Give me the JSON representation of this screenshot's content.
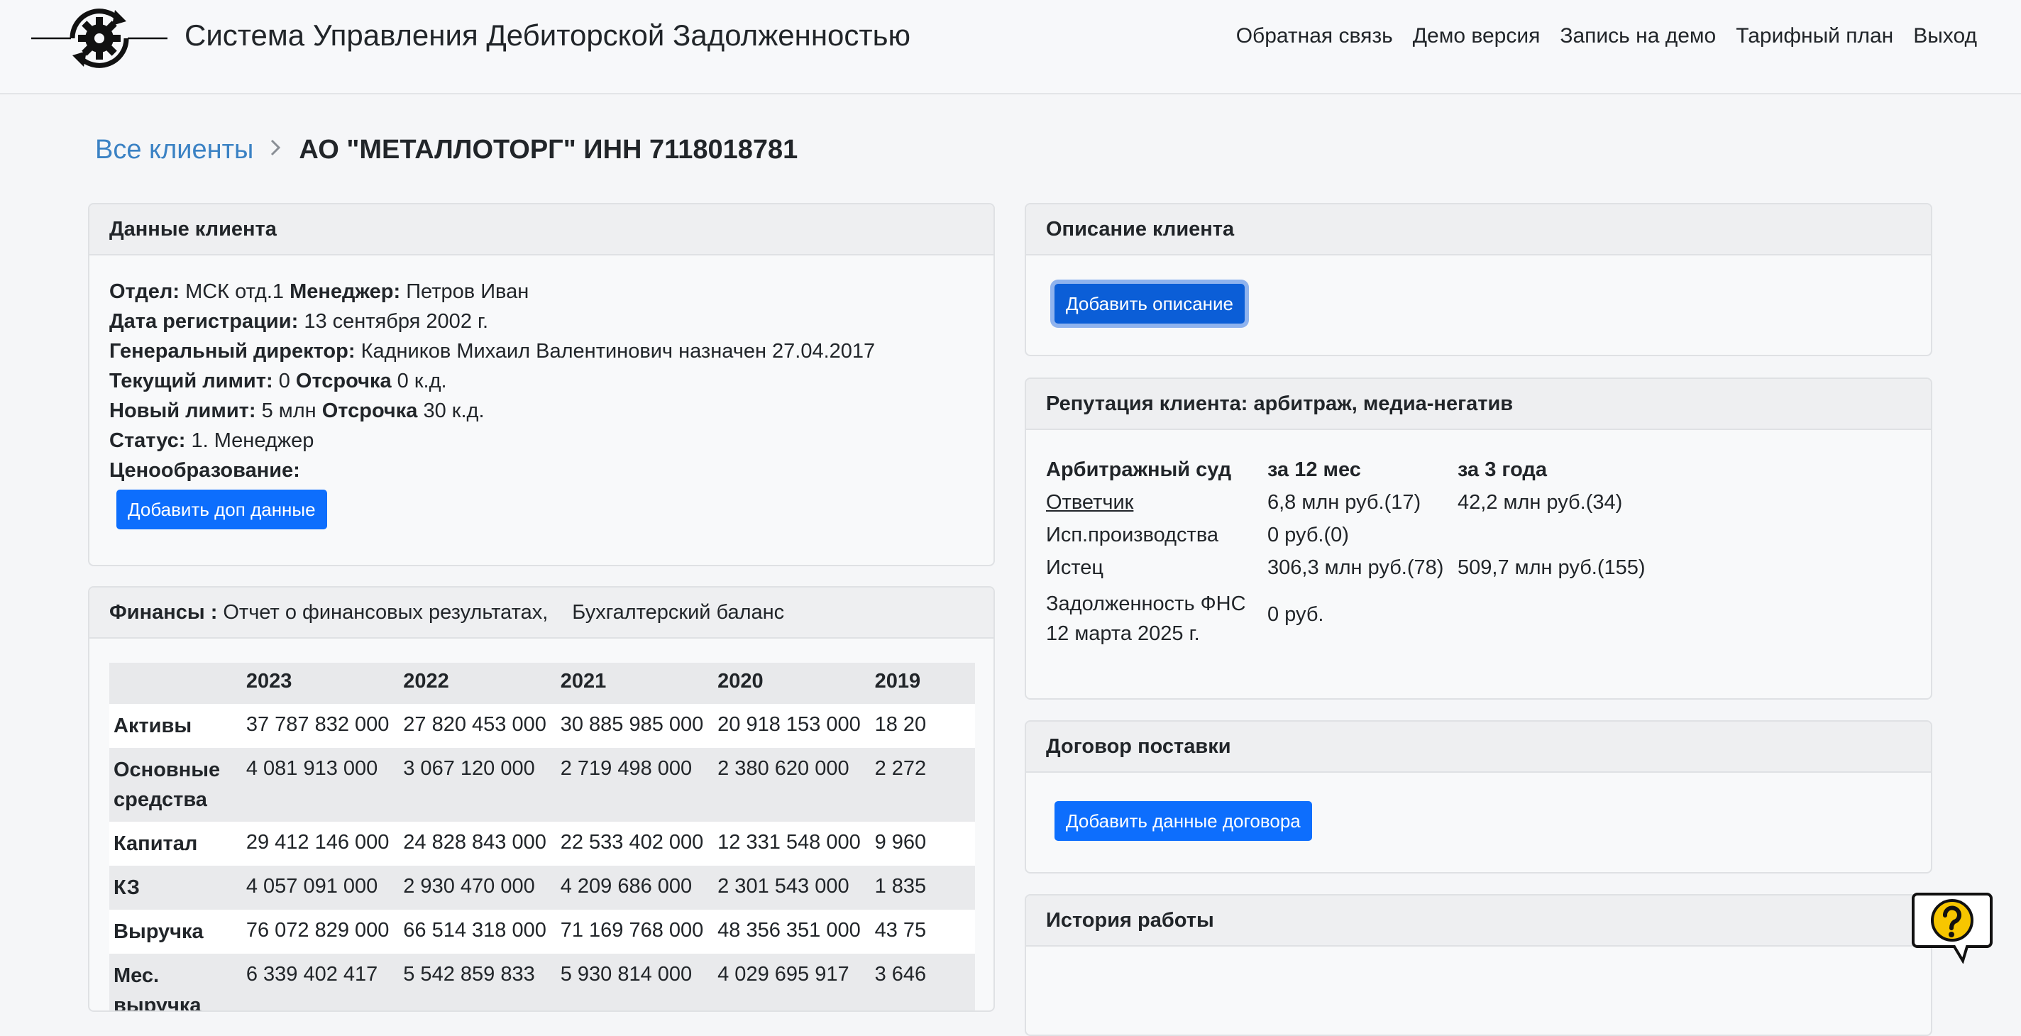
{
  "app": {
    "title": "Система Управления Дебиторской Задолженностью"
  },
  "nav": {
    "links": [
      "Обратная связь",
      "Демо версия",
      "Запись на демо",
      "Тарифный план",
      "Выход"
    ]
  },
  "breadcrumb": {
    "root": "Все клиенты",
    "current": "АО \"МЕТАЛЛОТОРГ\" ИНН 7118018781"
  },
  "client_data": {
    "header": "Данные клиента",
    "dept_label": "Отдел:",
    "dept_value": "МСК отд.1",
    "manager_label": "Менеджер:",
    "manager_value": "Петров Иван",
    "reg_label": "Дата регистрации:",
    "reg_value": "13 сентября 2002 г.",
    "ceo_label": "Генеральный директор:",
    "ceo_value": "Кадников Михаил Валентинович назначен 27.04.2017",
    "cur_limit_label": "Текущий лимит:",
    "cur_limit_value": "0",
    "delay_label": "Отсрочка",
    "cur_delay_value": "0 к.д.",
    "new_limit_label": "Новый лимит:",
    "new_limit_value": "5 млн",
    "new_delay_value": "30 к.д.",
    "status_label": "Статус:",
    "status_value": "1. Менеджер",
    "pricing_label": "Ценообразование:",
    "add_button": "Добавить доп данные"
  },
  "finance": {
    "header_bold": "Финансы :",
    "header_link1": "Отчет о финансовых результатах,",
    "header_link2": "Бухгалтерский баланс",
    "years": [
      "2023",
      "2022",
      "2021",
      "2020",
      "2019"
    ],
    "rows": [
      {
        "label": "Активы",
        "values": [
          "37 787 832 000",
          "27 820 453 000",
          "30 885 985 000",
          "20 918 153 000",
          "18 20"
        ]
      },
      {
        "label": "Основные средства",
        "values": [
          "4 081 913 000",
          "3 067 120 000",
          "2 719 498 000",
          "2 380 620 000",
          "2 272"
        ]
      },
      {
        "label": "Капитал",
        "values": [
          "29 412 146 000",
          "24 828 843 000",
          "22 533 402 000",
          "12 331 548 000",
          "9 960"
        ]
      },
      {
        "label": "КЗ",
        "values": [
          "4 057 091 000",
          "2 930 470 000",
          "4 209 686 000",
          "2 301 543 000",
          "1 835"
        ]
      },
      {
        "label": "Выручка",
        "values": [
          "76 072 829 000",
          "66 514 318 000",
          "71 169 768 000",
          "48 356 351 000",
          "43 75"
        ]
      },
      {
        "label": "Мес. выручка",
        "values": [
          "6 339 402 417",
          "5 542 859 833",
          "5 930 814 000",
          "4 029 695 917",
          "3 646"
        ]
      }
    ]
  },
  "description": {
    "header": "Описание клиента",
    "add_button": "Добавить описание"
  },
  "reputation": {
    "header": "Репутация клиента: арбитраж, медиа-негатив",
    "col_headers": [
      "Арбитражный суд",
      "за 12 мес",
      "за 3 года"
    ],
    "rows": [
      {
        "label": "Ответчик",
        "m12": "6,8 млн руб.(17)",
        "y3": "42,2 млн руб.(34)"
      },
      {
        "label": "Исп.производства",
        "m12": "0 руб.(0)",
        "y3": ""
      },
      {
        "label": "Истец",
        "m12": "306,3 млн руб.(78)",
        "y3": "509,7 млн руб.(155)"
      }
    ],
    "fns_label_line1": "Задолженность ФНС",
    "fns_label_line2": "12 марта 2025 г.",
    "fns_value": "0 руб."
  },
  "contract": {
    "header": "Договор поставки",
    "add_button": "Добавить данные договора"
  },
  "history": {
    "header": "История работы"
  },
  "icons": {
    "logo": "gear-sync-logo-icon",
    "breadcrumb_sep": "chevron-right-icon",
    "help": "help-question-bubble-icon"
  },
  "colors": {
    "primary_button": "#0d6efd",
    "link": "#3b82c4",
    "help_yellow": "#f7c600"
  }
}
